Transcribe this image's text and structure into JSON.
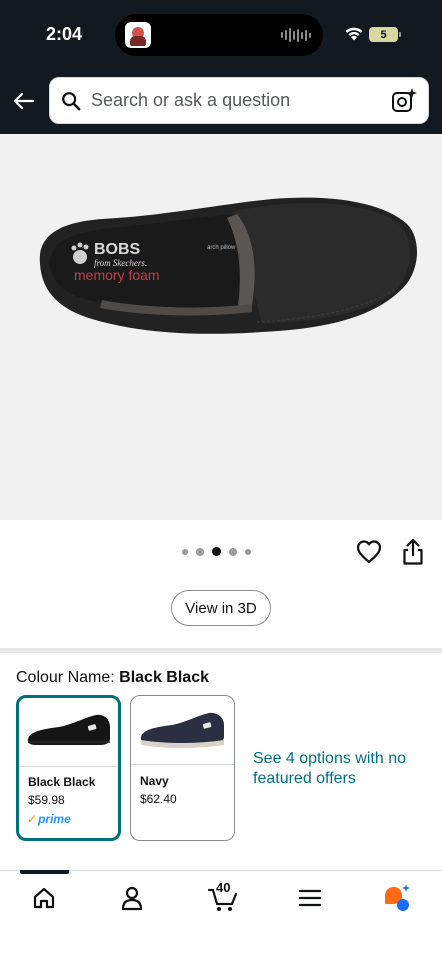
{
  "status_bar": {
    "time": "2:04",
    "battery": "5",
    "wifi_icon": "wifi-icon",
    "now_playing_icon": "audio-waveform-icon"
  },
  "header": {
    "back_icon": "back-arrow-icon",
    "search": {
      "placeholder": "Search or ask a question",
      "icon": "search-icon",
      "camera_icon": "camera-sparkle-icon"
    }
  },
  "product": {
    "image_carousel": {
      "dots": 5,
      "active_index": 2
    },
    "actions": {
      "wishlist_icon": "heart-icon",
      "share_icon": "share-icon",
      "view_3d": "View in 3D"
    },
    "colour": {
      "label": "Colour Name:",
      "value": "Black Black"
    },
    "swatches": [
      {
        "name": "Black Black",
        "price": "$59.98",
        "prime": "prime",
        "selected": true,
        "color": "#1a1a1a"
      },
      {
        "name": "Navy",
        "price": "$62.40",
        "prime": "",
        "selected": false,
        "color": "#2a3042"
      }
    ],
    "see_options": "See 4 options with no featured offers"
  },
  "bottom_nav": {
    "items": [
      {
        "name": "home",
        "icon": "home-icon"
      },
      {
        "name": "account",
        "icon": "person-icon"
      },
      {
        "name": "cart",
        "icon": "cart-icon",
        "count": "40"
      },
      {
        "name": "menu",
        "icon": "menu-icon"
      },
      {
        "name": "rufus",
        "icon": "rufus-assistant-icon"
      }
    ]
  },
  "colors": {
    "header_bg": "#131921",
    "link": "#007185",
    "selected_border": "#00707a",
    "prime_blue": "#1a98ff",
    "prime_check": "#ff9900",
    "rufus_orange": "#ff6a13",
    "rufus_blue": "#1a6bff"
  }
}
